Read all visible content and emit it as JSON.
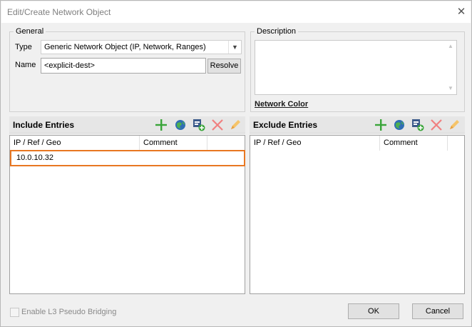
{
  "window": {
    "title": "Edit/Create Network Object"
  },
  "general": {
    "legend": "General",
    "type_label": "Type",
    "type_value": "Generic Network Object (IP, Network, Ranges)",
    "name_label": "Name",
    "name_value": "<explicit-dest>",
    "resolve_label": "Resolve"
  },
  "description": {
    "legend": "Description",
    "value": "",
    "network_color_link": "Network Color"
  },
  "include": {
    "title": "Include Entries",
    "columns": [
      "IP / Ref / Geo",
      "Comment"
    ],
    "rows": [
      {
        "ip": "10.0.10.32",
        "comment": ""
      }
    ]
  },
  "exclude": {
    "title": "Exclude Entries",
    "columns": [
      "IP / Ref / Geo",
      "Comment"
    ],
    "rows": []
  },
  "toolbar_icons": [
    "add-icon",
    "globe-icon",
    "add-reference-icon",
    "delete-icon",
    "edit-icon"
  ],
  "footer": {
    "checkbox_label": "Enable L3 Pseudo Bridging",
    "checkbox_checked": false,
    "ok_label": "OK",
    "cancel_label": "Cancel"
  },
  "colors": {
    "selection_border": "#e87722",
    "add_green": "#3aa53a",
    "delete_red": "#e06060",
    "edit_yellow": "#f0b040"
  }
}
